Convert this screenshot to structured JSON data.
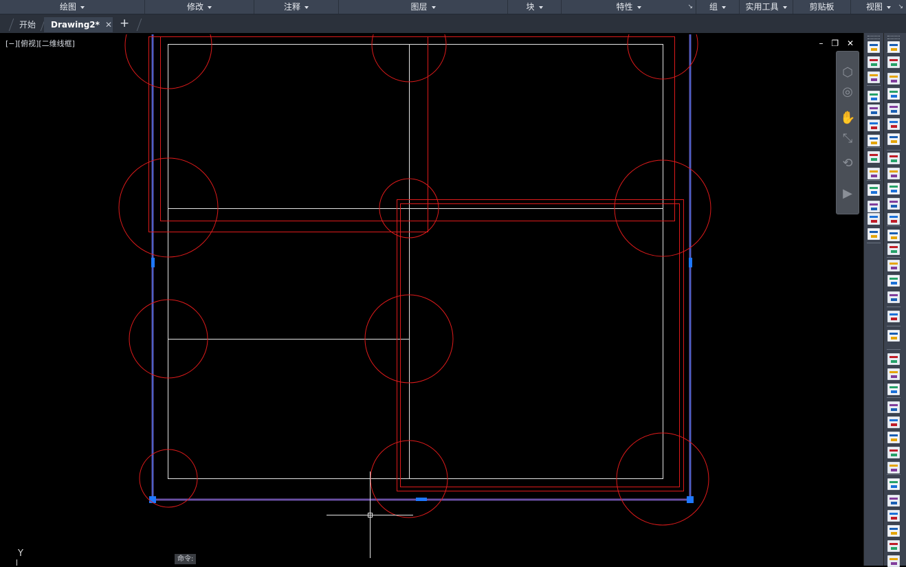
{
  "ribbon": {
    "panels": [
      {
        "label": "绘图",
        "dropdown": true
      },
      {
        "label": "修改",
        "dropdown": true
      },
      {
        "label": "注释",
        "dropdown": true
      },
      {
        "label": "图层",
        "dropdown": true
      },
      {
        "label": "块",
        "dropdown": true
      },
      {
        "label": "特性",
        "dropdown": true
      },
      {
        "label": "组",
        "dropdown": true
      },
      {
        "label": "实用工具",
        "dropdown": true
      },
      {
        "label": "剪贴板",
        "dropdown": false
      },
      {
        "label": "视图",
        "dropdown": true
      }
    ]
  },
  "tabs": {
    "start_label": "开始",
    "active_label": "Drawing2*",
    "close_symbol": "✕",
    "new_tab_symbol": "+"
  },
  "viewport": {
    "view_label": "[−][俯视][二维线框]",
    "minimize": "–",
    "restore": "❐",
    "close": "✕"
  },
  "ucs": {
    "y_label": "Y"
  },
  "command_line": {
    "prompt": "命令:"
  },
  "colors": {
    "background": "#000000",
    "wall_lines": "#e6e6e6",
    "red_geometry": "#e01b1b",
    "selection": "#6a4fa3",
    "grip": "#1e78ff",
    "ribbon": "#3b4453",
    "toolbar": "#3c4350"
  },
  "icons": {
    "nav_bar": [
      "view-cube-icon",
      "steering-wheel-icon",
      "pan-hand-icon",
      "zoom-extents-icon",
      "orbit-icon",
      "showmotion-icon"
    ],
    "toolbar": [
      "dimension-icons",
      "text-icons",
      "block-icons"
    ]
  }
}
